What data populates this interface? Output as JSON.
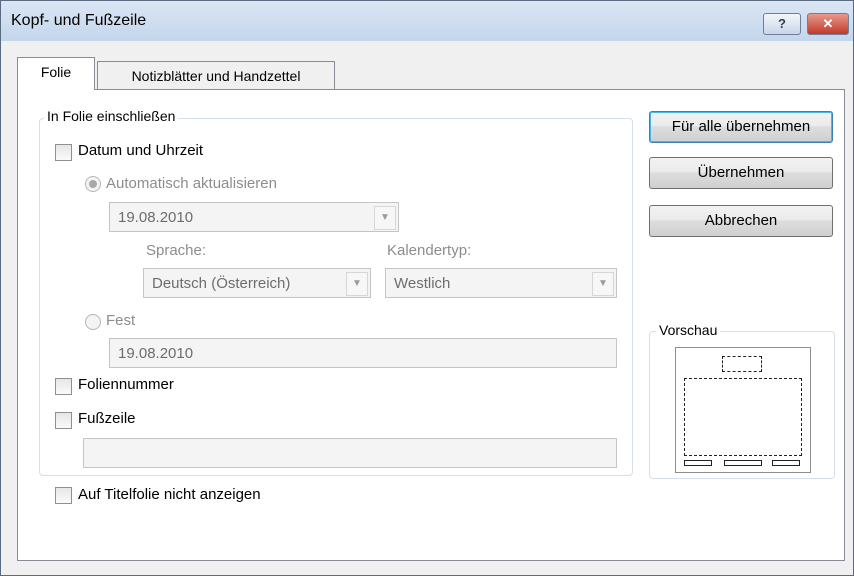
{
  "window": {
    "title": "Kopf- und Fußzeile",
    "help_glyph": "?",
    "close_glyph": "✕"
  },
  "tabs": [
    {
      "label": "Folie"
    },
    {
      "label": "Notizblätter und Handzettel"
    }
  ],
  "include_group": {
    "legend": "In Folie einschließen",
    "date_time": {
      "label": "Datum und Uhrzeit",
      "checked": false
    },
    "auto_update": {
      "label": "Automatisch aktualisieren",
      "selected": true,
      "value": "19.08.2010"
    },
    "language": {
      "label": "Sprache:",
      "value": "Deutsch (Österreich)"
    },
    "calendar": {
      "label": "Kalendertyp:",
      "value": "Westlich"
    },
    "fixed": {
      "label": "Fest",
      "selected": false,
      "value": "19.08.2010"
    },
    "slide_number": {
      "label": "Foliennummer",
      "checked": false
    },
    "footer": {
      "label": "Fußzeile",
      "checked": false,
      "value": ""
    }
  },
  "title_slide": {
    "label": "Auf Titelfolie nicht anzeigen",
    "checked": false
  },
  "buttons": {
    "apply_all": "Für alle übernehmen",
    "apply": "Übernehmen",
    "cancel": "Abbrechen"
  },
  "preview": {
    "legend": "Vorschau"
  },
  "dropdown_glyph": "▼"
}
